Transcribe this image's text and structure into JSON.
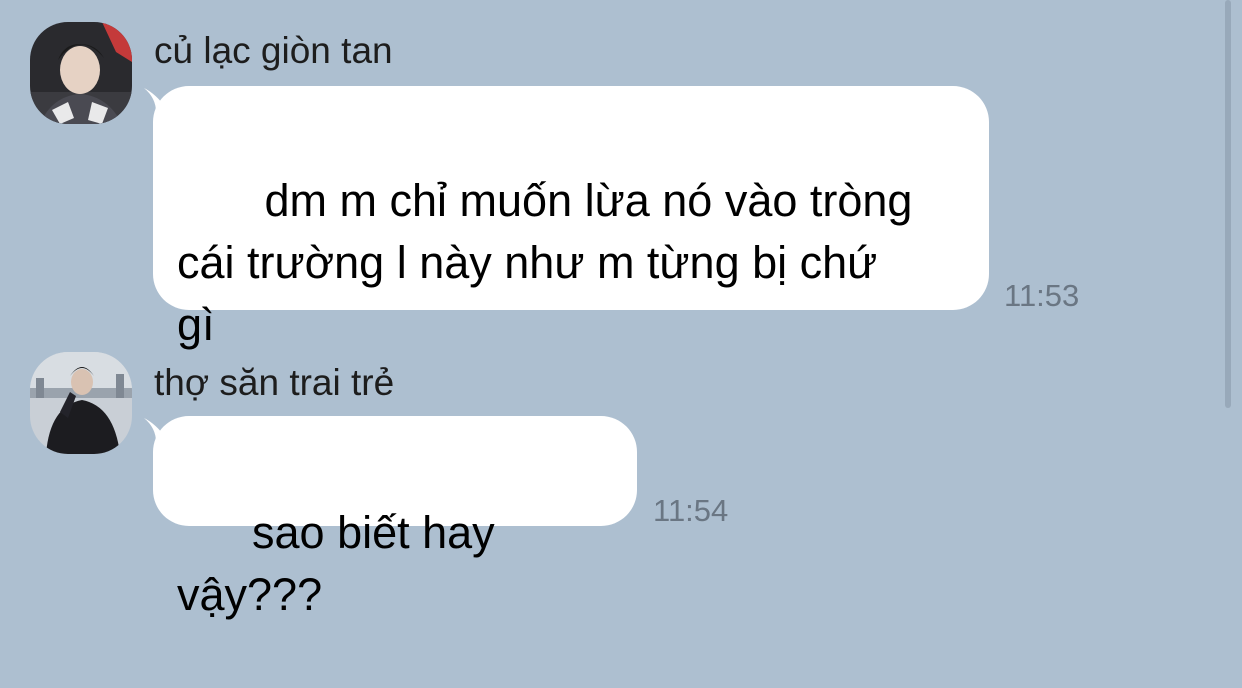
{
  "chat": {
    "messages": [
      {
        "sender": "củ lạc giòn tan",
        "avatar": "avatar-photo",
        "text": " dm m chỉ muốn lừa nó vào tròng\ncái trường l này như m từng bị chứ\ngì",
        "time": "11:53"
      },
      {
        "sender": "thợ săn trai trẻ",
        "avatar": "avatar-photo",
        "text": "sao biết hay vậy???",
        "time": "11:54"
      }
    ]
  },
  "colors": {
    "background": "#adbfd0",
    "bubble": "#ffffff",
    "timestamp": "#6a7683"
  }
}
